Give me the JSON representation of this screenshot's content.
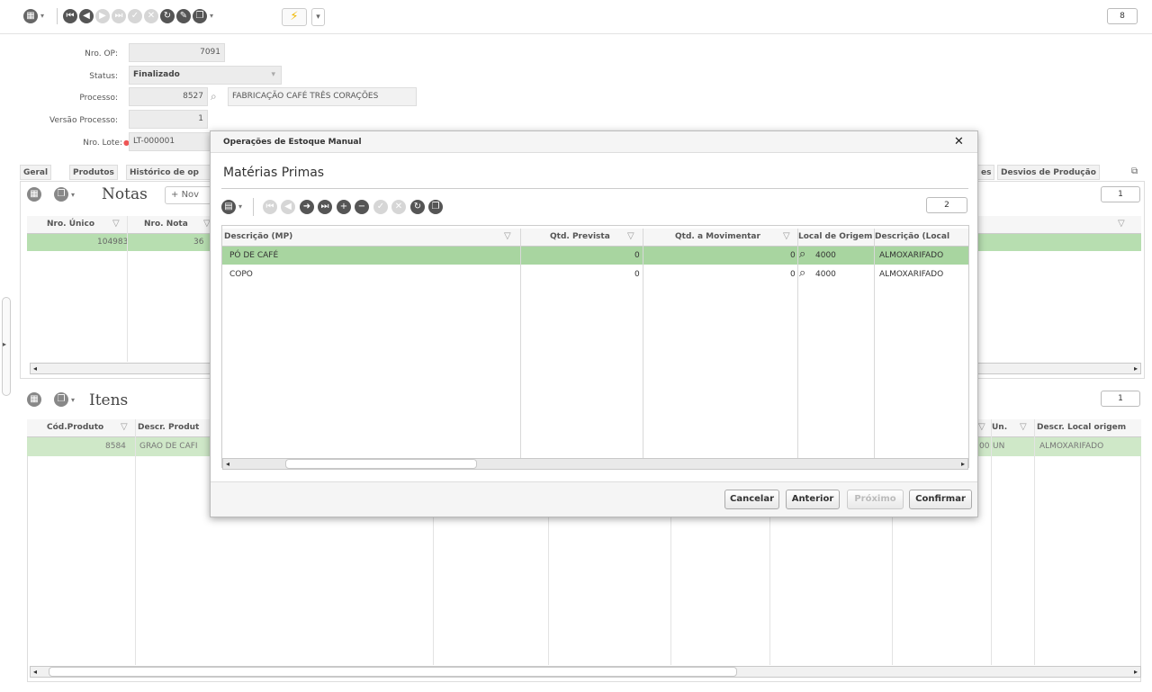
{
  "toolbar": {
    "badge": "8"
  },
  "form": {
    "op_label": "Nro. OP:",
    "op_value": "7091",
    "status_label": "Status:",
    "status_value": "Finalizado",
    "processo_label": "Processo:",
    "processo_value": "8527",
    "processo_desc": "FABRICAÇÃO CAFÉ TRÊS CORAÇÕES",
    "versao_label": "Versão Processo:",
    "versao_value": "1",
    "lote_label": "Nro. Lote:",
    "lote_value": "LT-000001"
  },
  "tabs": {
    "geral": "Geral",
    "produtos": "Produtos",
    "historico": "Histórico de op",
    "tail_s": "es",
    "desvios": "Desvios de Produção"
  },
  "notas": {
    "title": "Notas",
    "novo": "Nov",
    "count": "1",
    "col_unico": "Nro. Único",
    "col_nota": "Nro. Nota",
    "row_unico": "104983",
    "row_nota": "36"
  },
  "itens": {
    "title": "Itens",
    "count": "1",
    "col_cod": "Cód.Produto",
    "col_descr": "Descr. Produt",
    "col_un": "Un.",
    "col_local": "Descr. Local origem",
    "row_cod": "8584",
    "row_descr": "GRÃO DE CAFI",
    "row_qtd": "00",
    "row_un": "UN",
    "row_local": "ALMOXARIFADO"
  },
  "modal": {
    "title": "Operações de Estoque Manual",
    "close": "✕",
    "section": "Matérias Primas",
    "count": "2",
    "columns": [
      "Descrição (MP)",
      "Qtd. Prevista",
      "Qtd. a Movimentar",
      "Local de Origem",
      "Descrição (Local"
    ],
    "rows": [
      {
        "desc": "PÓ DE CAFÉ",
        "prev": "0",
        "mov": "0",
        "local": "4000",
        "local_desc": "ALMOXARIFADO"
      },
      {
        "desc": "COPO",
        "prev": "0",
        "mov": "0",
        "local": "4000",
        "local_desc": "ALMOXARIFADO"
      }
    ],
    "buttons": {
      "cancelar": "Cancelar",
      "anterior": "Anterior",
      "proximo": "Próximo",
      "confirmar": "Confirmar"
    }
  },
  "colors": {
    "selected_row": "#a8d5a0",
    "row_green": "#cfe8c8",
    "accent_lightning": "#f0b800"
  }
}
